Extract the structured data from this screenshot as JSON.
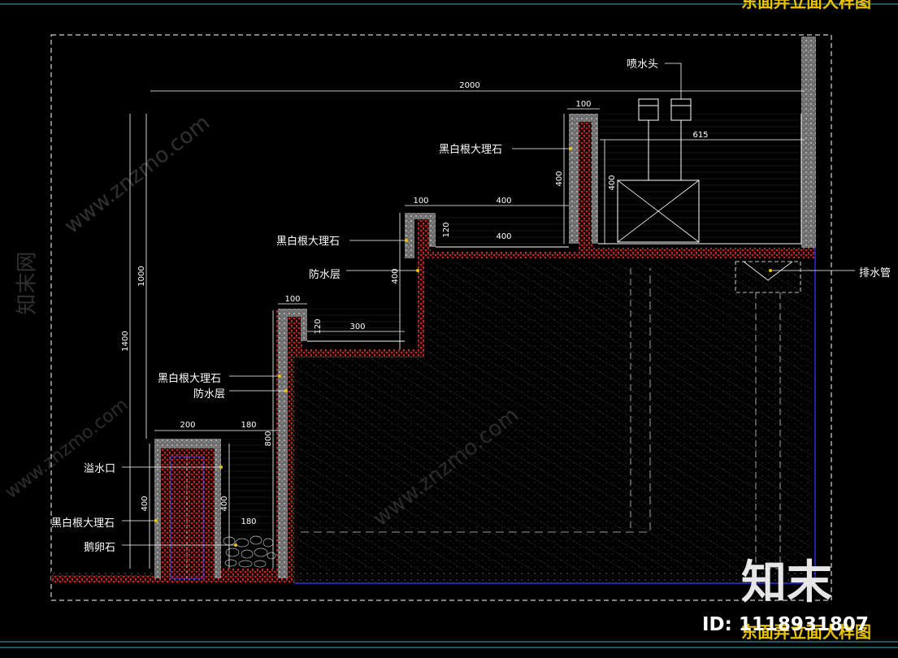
{
  "drawing_title_top": "东面弄立面大样图",
  "drawing_title_bottom": "东面弄立面大样图",
  "labels": {
    "nozzle": "喷水头",
    "marble_1": "黑白根大理石",
    "marble_2": "黑白根大理石",
    "waterproof_1": "防水层",
    "marble_3": "黑白根大理石",
    "waterproof_2": "防水层",
    "overflow": "溢水口",
    "marble_4": "黑白根大理石",
    "pebble": "鹅卵石",
    "drain": "排水管"
  },
  "dimensions": {
    "total_width": "2000",
    "top_wall": "100",
    "top_span": "615",
    "top_height": "400",
    "top_inner_height": "400",
    "mid_wall": "100",
    "mid_span_top": "400",
    "mid_span_bottom": "400",
    "mid_small": "120",
    "mid_height": "400",
    "low_wall": "100",
    "low_span": "300",
    "low_small": "120",
    "left_1000": "1000",
    "left_1400": "1400",
    "bottom_200": "200",
    "bottom_180": "180",
    "bottom_800": "800",
    "bottom_400_left": "400",
    "bottom_400_right": "400",
    "bottom_180b": "180"
  },
  "watermarks": {
    "site": "www.znzmo.com",
    "brand": "知末",
    "brand_side": "知末网",
    "id": "ID: 1118931807"
  }
}
